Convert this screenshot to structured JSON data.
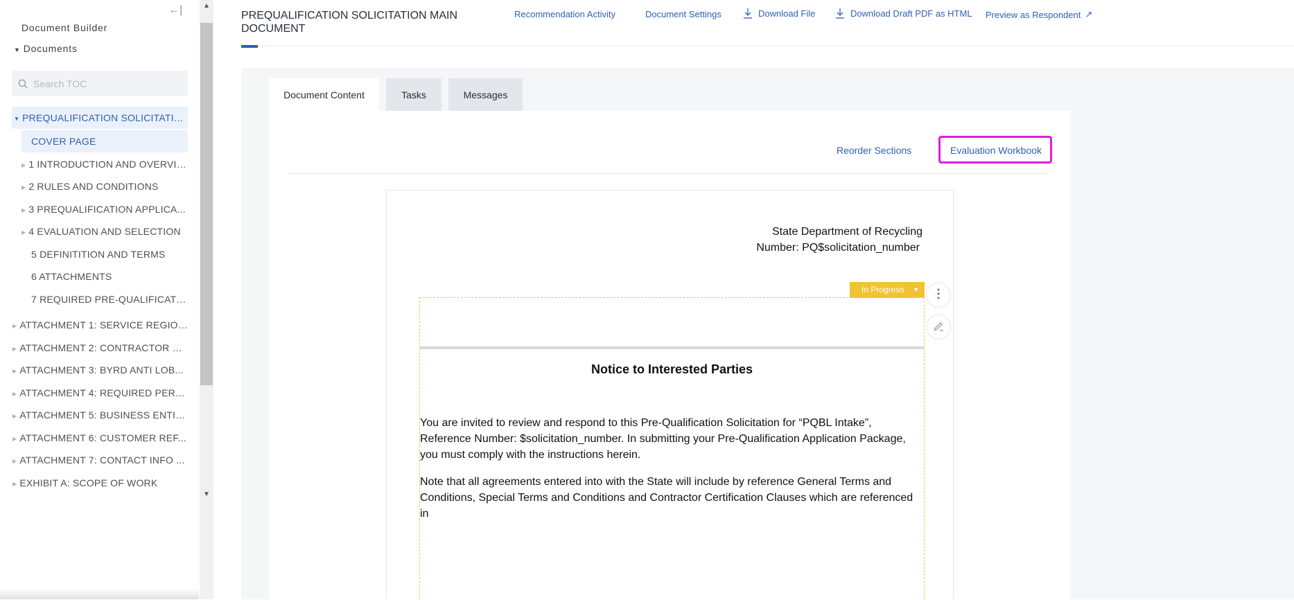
{
  "sidebar": {
    "collapse_icon": "←|",
    "title": "Document Builder",
    "section": "Documents",
    "search_placeholder": "Search TOC",
    "items": [
      {
        "label": "PREQUALIFICATION SOLICITATIO...",
        "expandable": true,
        "expanded": true
      },
      {
        "label": "COVER PAGE"
      },
      {
        "label": "1 INTRODUCTION AND OVERVIE...",
        "expandable": true
      },
      {
        "label": "2 RULES AND CONDITIONS",
        "expandable": true
      },
      {
        "label": "3 PREQUALIFICATION APPLICA...",
        "expandable": true
      },
      {
        "label": "4 EVALUATION AND SELECTION",
        "expandable": true
      },
      {
        "label": "5 DEFINITITION AND TERMS"
      },
      {
        "label": "6 ATTACHMENTS"
      },
      {
        "label": "7 REQUIRED PRE-QUALIFICATIO..."
      },
      {
        "label": "ATTACHMENT 1: SERVICE REGION...",
        "expandable": true
      },
      {
        "label": "ATTACHMENT 2: CONTRACTOR C...",
        "expandable": true
      },
      {
        "label": "ATTACHMENT 3: BYRD ANTI LOB...",
        "expandable": true
      },
      {
        "label": "ATTACHMENT 4: REQUIRED PERS...",
        "expandable": true
      },
      {
        "label": "ATTACHMENT 5: BUSINESS ENTIT...",
        "expandable": true
      },
      {
        "label": "ATTACHMENT 6: CUSTOMER REF...",
        "expandable": true
      },
      {
        "label": "ATTACHMENT 7: CONTACT INFO ...",
        "expandable": true
      },
      {
        "label": "EXHIBIT A: SCOPE OF WORK",
        "expandable": true
      }
    ]
  },
  "header": {
    "title": "PREQUALIFICATION SOLICITATION MAIN DOCUMENT",
    "actions": {
      "recommendation": "Recommendation Activity",
      "settings": "Document Settings",
      "download_file": "Download File",
      "download_draft": "Download Draft PDF as HTML",
      "preview": "Preview as Respondent"
    }
  },
  "tabs": {
    "content": "Document Content",
    "tasks": "Tasks",
    "messages": "Messages"
  },
  "content_actions": {
    "reorder": "Reorder Sections",
    "workbook": "Evaluation Workbook"
  },
  "document": {
    "agency": "State Department of Recycling",
    "number": "Number: PQ$solicitation_number",
    "status": "In Progress",
    "notice_title": "Notice to Interested Parties",
    "paragraph_1": "You are invited to review and respond to this Pre-Qualification Solicitation for “PQBL Intake”, Reference Number: $solicitation_number. In submitting your Pre-Qualification Application Package, you must comply with the instructions herein.",
    "paragraph_2": "Note that all agreements entered into with the State will include by reference General Terms and Conditions, Special Terms and Conditions and Contractor Certification Clauses which are referenced in"
  },
  "colors": {
    "accent": "#2f5fb3",
    "status": "#f1c232",
    "highlight": "#e21cdc"
  }
}
